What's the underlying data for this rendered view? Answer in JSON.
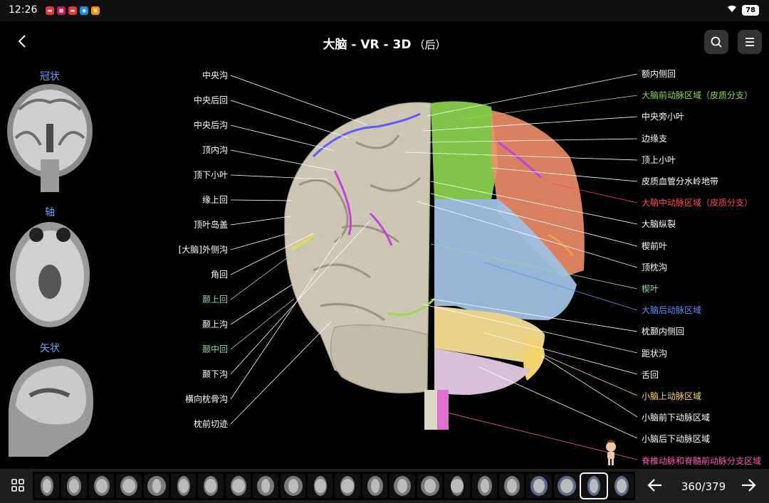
{
  "status": {
    "time": "12:26",
    "battery": "78",
    "app_colors": [
      "#e53935",
      "#c2185b",
      "#e53935",
      "#1e88e5",
      "#fb8c00"
    ]
  },
  "header": {
    "title": "大脑 - VR - 3D",
    "title_suffix": "（后）"
  },
  "views": {
    "coronal": "冠状",
    "axial": "轴",
    "sagittal": "矢状"
  },
  "labels_left": [
    {
      "text": "中央沟",
      "color": "#ffffff"
    },
    {
      "text": "中央后回",
      "color": "#ffffff"
    },
    {
      "text": "中央后沟",
      "color": "#ffffff"
    },
    {
      "text": "顶内沟",
      "color": "#ffffff"
    },
    {
      "text": "顶下小叶",
      "color": "#ffffff"
    },
    {
      "text": "缘上回",
      "color": "#ffffff"
    },
    {
      "text": "顶叶岛盖",
      "color": "#ffffff"
    },
    {
      "text": "[大脑]外侧沟",
      "color": "#ffffff"
    },
    {
      "text": "角回",
      "color": "#ffffff"
    },
    {
      "text": "颞上回",
      "color": "#8fd99b"
    },
    {
      "text": "颞上沟",
      "color": "#ffffff"
    },
    {
      "text": "颞中回",
      "color": "#8fd99b"
    },
    {
      "text": "颞下沟",
      "color": "#ffffff"
    },
    {
      "text": "横向枕骨沟",
      "color": "#ffffff"
    },
    {
      "text": "枕前切迹",
      "color": "#ffffff"
    }
  ],
  "labels_right": [
    {
      "text": "额内侧回",
      "color": "#ffffff"
    },
    {
      "text": "大脑前动脉区域（皮质分支）",
      "color": "#8fd94f"
    },
    {
      "text": "中央旁小叶",
      "color": "#ffffff"
    },
    {
      "text": "边缘支",
      "color": "#ffffff"
    },
    {
      "text": "顶上小叶",
      "color": "#ffffff"
    },
    {
      "text": "皮质血管分水岭地带",
      "color": "#ffffff"
    },
    {
      "text": "大脑中动脉区域（皮质分支）",
      "color": "#ff4a4a"
    },
    {
      "text": "大脑纵裂",
      "color": "#ffffff"
    },
    {
      "text": "楔前叶",
      "color": "#ffffff"
    },
    {
      "text": "顶枕沟",
      "color": "#ffffff"
    },
    {
      "text": "楔叶",
      "color": "#8fd99b"
    },
    {
      "text": "大脑后动脉区域",
      "color": "#5b8fff"
    },
    {
      "text": "枕颞内侧回",
      "color": "#ffffff"
    },
    {
      "text": "距状沟",
      "color": "#ffffff"
    },
    {
      "text": "舌回",
      "color": "#ffffff"
    },
    {
      "text": "小脑上动脉区域",
      "color": "#ffd966"
    },
    {
      "text": "小脑前下动脉区域",
      "color": "#ffffff"
    },
    {
      "text": "小脑后下动脉区域",
      "color": "#ffffff"
    },
    {
      "text": "脊椎动脉和脊髓前动脉分支区域",
      "color": "#ff5ab4"
    }
  ],
  "pager": {
    "current": "360/379"
  }
}
